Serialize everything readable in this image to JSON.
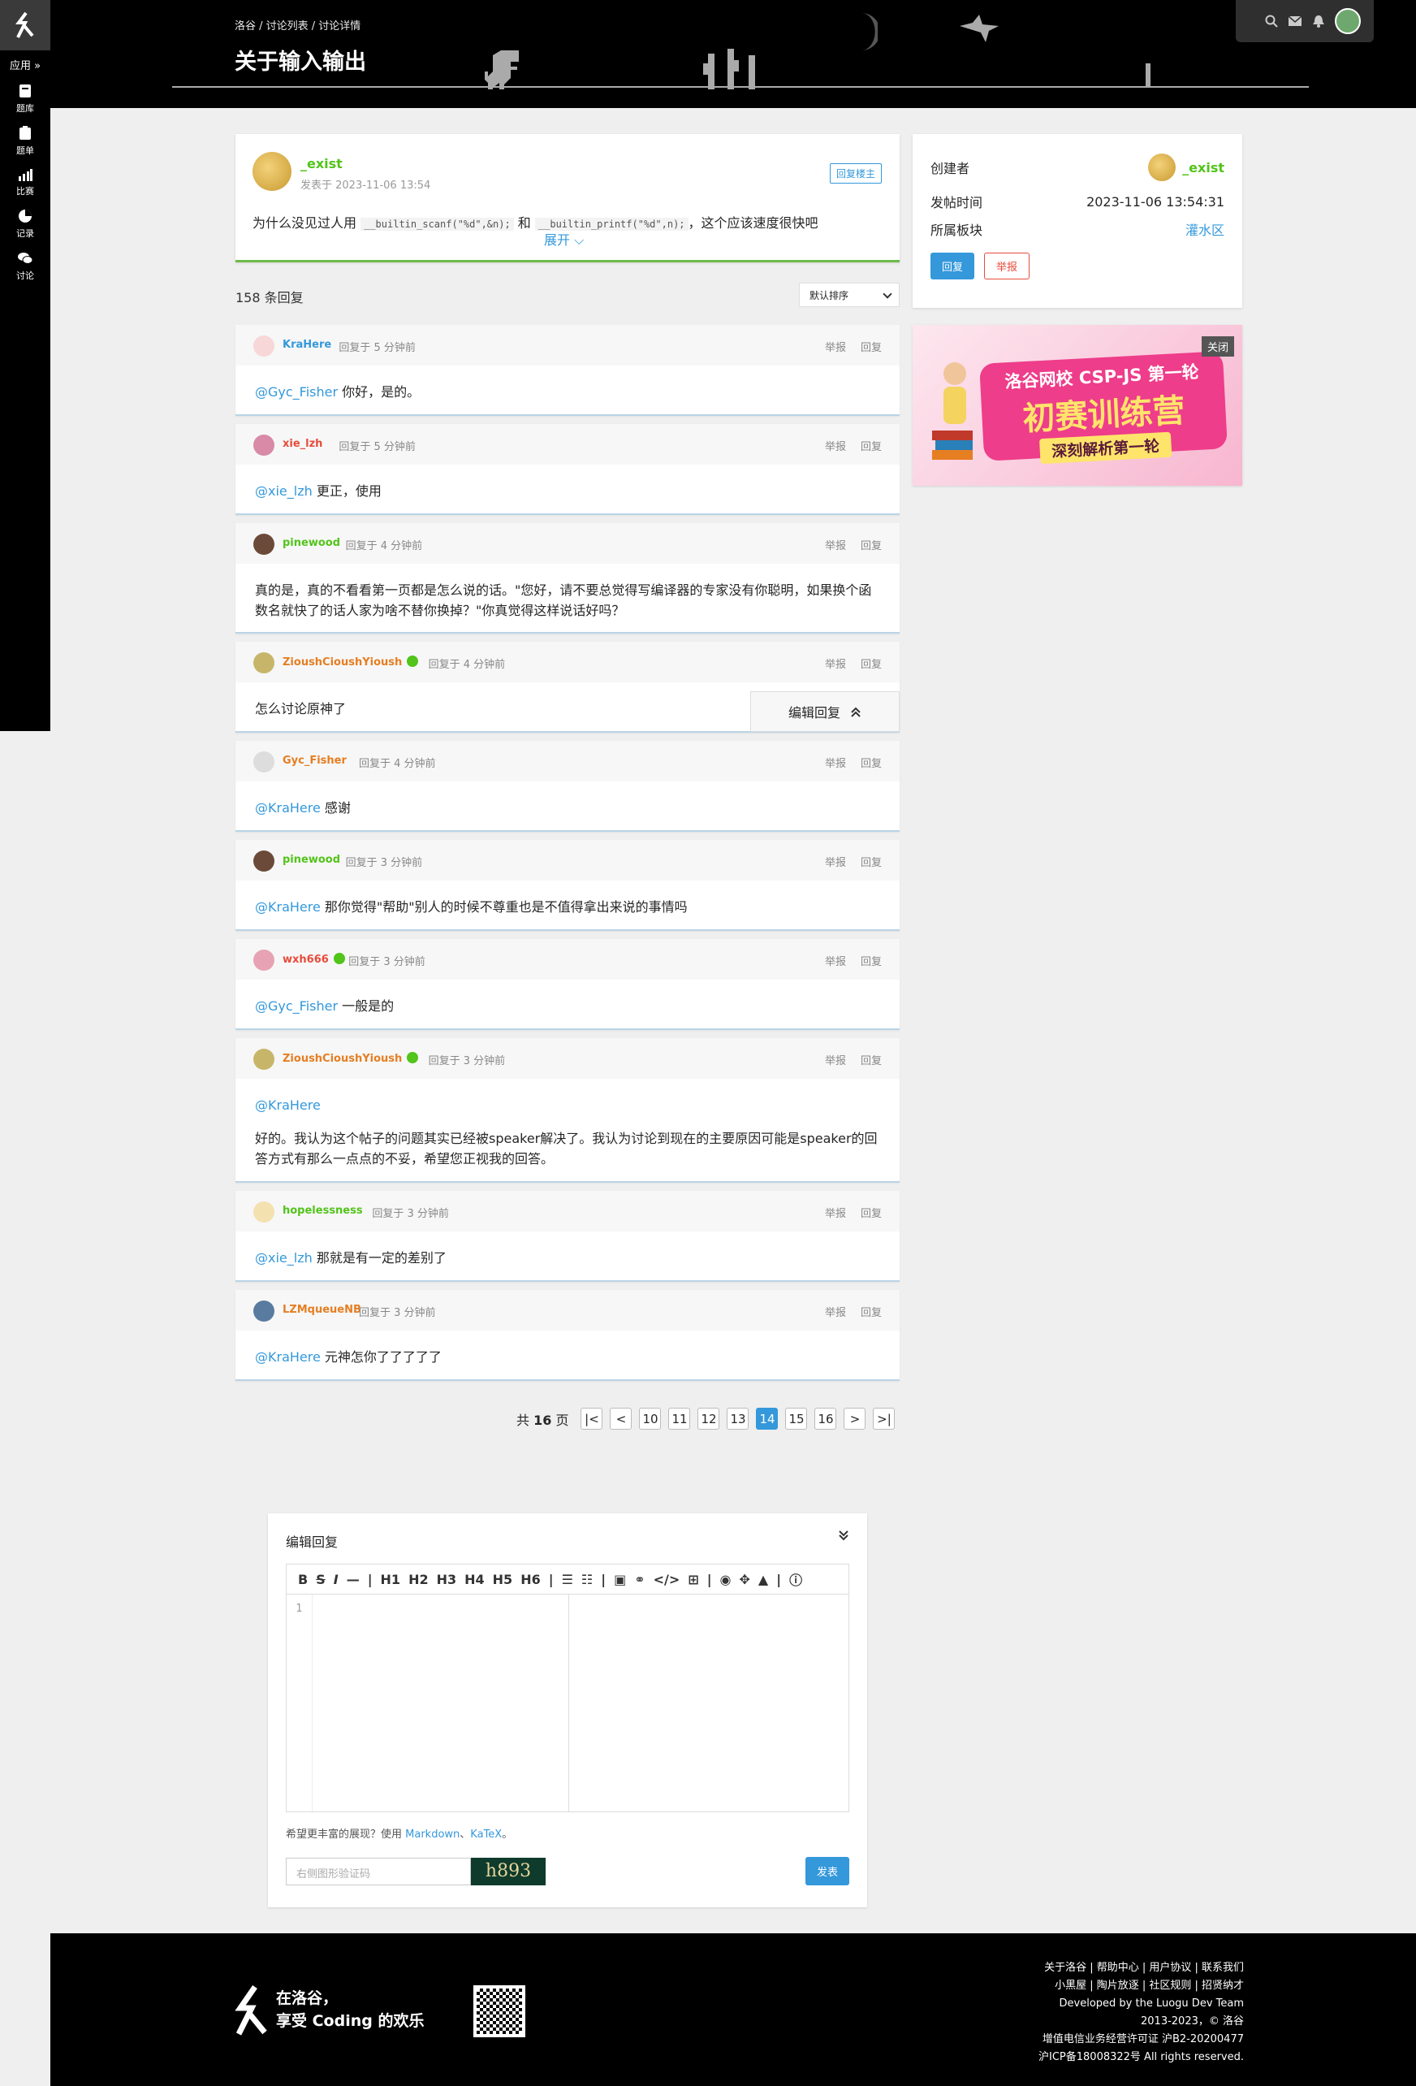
{
  "sidebar": {
    "apps_label": "应用 »",
    "items": [
      {
        "label": "题库",
        "icon": "book-icon"
      },
      {
        "label": "题单",
        "icon": "clipboard-icon"
      },
      {
        "label": "比赛",
        "icon": "bar-chart-icon"
      },
      {
        "label": "记录",
        "icon": "pie-chart-icon"
      },
      {
        "label": "讨论",
        "icon": "chat-icon"
      }
    ]
  },
  "header": {
    "breadcrumb": "洛谷 / 讨论列表 / 讨论详情",
    "title": "关于输入输出"
  },
  "op": {
    "author": "_exist",
    "time": "发表于 2023-11-06 13:54",
    "reply_op_label": "回复楼主",
    "text_before": "为什么没见过人用 ",
    "code1": "__builtin_scanf(\"%d\",&n);",
    "text_mid": " 和 ",
    "code2": "__builtin_printf(\"%d\",n);",
    "text_after": "，这个应该速度很快吧",
    "expand_label": "展开 ⌵"
  },
  "info": {
    "creator_label": "创建者",
    "creator": "_exist",
    "time_label": "发帖时间",
    "time": "2023-11-06 13:54:31",
    "board_label": "所属板块",
    "board": "灌水区",
    "reply_btn": "回复",
    "report_btn": "举报"
  },
  "ad": {
    "close_label": "关闭",
    "line1": "洛谷网校 CSP-JS 第一轮",
    "line2": "初赛训练营",
    "line3": "深刻解析第一轮"
  },
  "replies_meta": {
    "count": "158 条回复",
    "sort": "默认排序",
    "report": "举报",
    "reply": "回复"
  },
  "replies": [
    {
      "name": "KraHere",
      "color": "#3498db",
      "time": "回复于 5 分钟前",
      "at": "@Gyc_Fisher",
      "text": " 你好，是的。"
    },
    {
      "name": "xie_lzh",
      "color": "#e74c3c",
      "time": "回复于 5 分钟前",
      "at": "@xie_lzh",
      "text": " 更正，使用"
    },
    {
      "name": "pinewood",
      "color": "#52c41a",
      "time": "回复于 4 分钟前",
      "at": "",
      "text": "真的是，真的不看看第一页都是怎么说的话。\"您好，请不要总觉得写编译器的专家没有你聪明，如果换个函数名就快了的话人家为啥不替你换掉？\"你真觉得这样说话好吗？"
    },
    {
      "name": "ZioushCioushYioush",
      "color": "#e67e22",
      "time": "回复于 4 分钟前",
      "at": "",
      "text": "怎么讨论原神了"
    },
    {
      "name": "Gyc_Fisher",
      "color": "#e67e22",
      "time": "回复于 4 分钟前",
      "at": "@KraHere",
      "text": " 感谢"
    },
    {
      "name": "pinewood",
      "color": "#52c41a",
      "time": "回复于 3 分钟前",
      "at": "@KraHere",
      "text": " 那你觉得\"帮助\"别人的时候不尊重也是不值得拿出来说的事情吗"
    },
    {
      "name": "wxh666",
      "color": "#e74c3c",
      "time": "回复于 3 分钟前",
      "at": "@Gyc_Fisher",
      "text": " 一般是的"
    },
    {
      "name": "ZioushCioushYioush",
      "color": "#e67e22",
      "time": "回复于 3 分钟前",
      "at": "@KraHere",
      "text": "好的。我认为这个帖子的问题其实已经被speaker解决了。我认为讨论到现在的主要原因可能是speaker的回答方式有那么一点点的不妥，希望您正视我的回答。"
    },
    {
      "name": "hopelessness",
      "color": "#52c41a",
      "time": "回复于 3 分钟前",
      "at": "@xie_lzh",
      "text": " 那就是有一定的差别了"
    },
    {
      "name": "LZMqueueNB",
      "color": "#e67e22",
      "time": "回复于 3 分钟前",
      "at": "@KraHere",
      "text": " 元神怎你了了了了了"
    }
  ],
  "edit_float_label": "编辑回复",
  "pager": {
    "total_prefix": "共",
    "total": "16",
    "total_suffix": "页",
    "first": "|<",
    "prev": "<",
    "pages": [
      "10",
      "11",
      "12",
      "13",
      "14",
      "15",
      "16"
    ],
    "current": "14",
    "next": ">",
    "last": ">|"
  },
  "editor": {
    "title": "编辑回复",
    "line_number": "1",
    "hint_prefix": "希望更丰富的展现？使用 ",
    "markdown": "Markdown",
    "sep": "、",
    "katex": "KaTeX",
    "hint_suffix": "。",
    "captcha_placeholder": "右侧图形验证码",
    "captcha_text": "h893",
    "publish": "发表"
  },
  "footer": {
    "slogan1": "在洛谷，",
    "slogan2": "享受 Coding 的欢乐",
    "links1": "关于洛谷 | 帮助中心 | 用户协议 | 联系我们",
    "links2": "小黑屋 | 陶片放逐 | 社区规则 | 招贤纳才",
    "dev": "Developed by the Luogu Dev Team",
    "copyright": "2013-2023，© 洛谷",
    "license": "增值电信业务经营许可证 沪B2-20200477",
    "icp": "沪ICP备18008322号 All rights reserved."
  }
}
